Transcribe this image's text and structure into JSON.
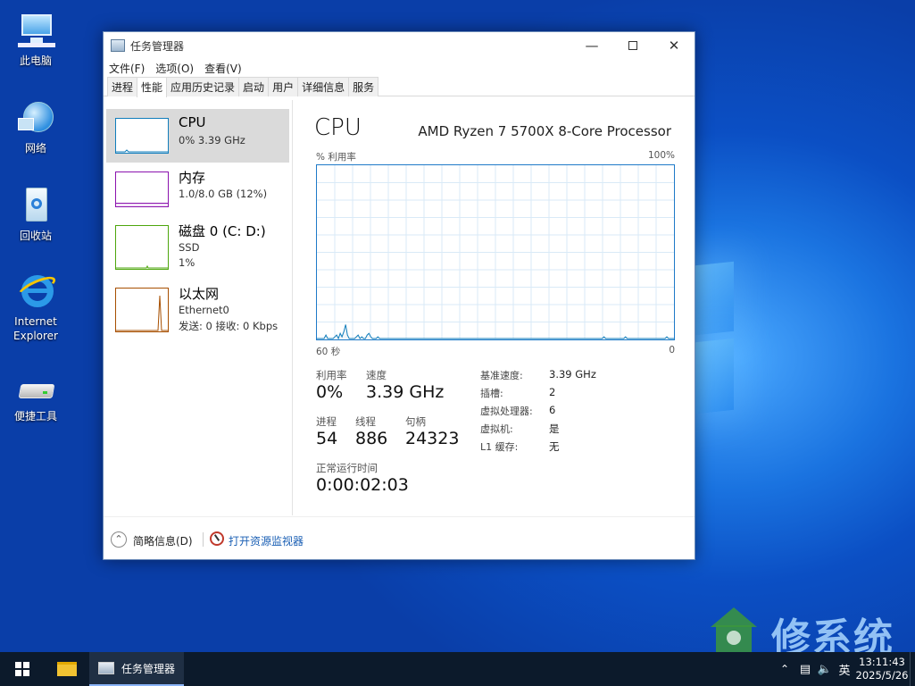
{
  "desktop": {
    "icons": [
      {
        "label": "此电脑"
      },
      {
        "label": "网络"
      },
      {
        "label": "回收站"
      },
      {
        "label": "Internet Explorer"
      },
      {
        "label": "便捷工具"
      }
    ]
  },
  "window": {
    "title": "任务管理器",
    "menu": [
      "文件(F)",
      "选项(O)",
      "查看(V)"
    ],
    "tabs": [
      "进程",
      "性能",
      "应用历史记录",
      "启动",
      "用户",
      "详细信息",
      "服务"
    ],
    "active_tab": "性能"
  },
  "sidebar": {
    "items": [
      {
        "title": "CPU",
        "lines": [
          "0% 3.39 GHz"
        ],
        "color": "#117dbb"
      },
      {
        "title": "内存",
        "lines": [
          "1.0/8.0 GB (12%)"
        ],
        "color": "#8b12ae"
      },
      {
        "title": "磁盘 0 (C: D:)",
        "lines": [
          "SSD",
          "1%"
        ],
        "color": "#4da60c"
      },
      {
        "title": "以太网",
        "lines": [
          "Ethernet0",
          "发送: 0 接收: 0 Kbps"
        ],
        "color": "#a74f01"
      }
    ]
  },
  "cpu_panel": {
    "heading": "CPU",
    "processor": "AMD Ryzen 7 5700X 8-Core Processor",
    "graph_ylabel": "% 利用率",
    "graph_ymax": "100%",
    "graph_xleft": "60 秒",
    "graph_xright": "0",
    "stats": {
      "util_label": "利用率",
      "util_value": "0%",
      "speed_label": "速度",
      "speed_value": "3.39 GHz",
      "proc_label": "进程",
      "proc_value": "54",
      "thread_label": "线程",
      "thread_value": "886",
      "handle_label": "句柄",
      "handle_value": "24323",
      "uptime_label": "正常运行时间",
      "uptime_value": "0:00:02:03"
    },
    "right_stats": [
      {
        "label": "基准速度:",
        "value": "3.39 GHz"
      },
      {
        "label": "插槽:",
        "value": "2"
      },
      {
        "label": "虚拟处理器:",
        "value": "6"
      },
      {
        "label": "虚拟机:",
        "value": "是"
      },
      {
        "label": "L1 缓存:",
        "value": "无"
      }
    ]
  },
  "footer": {
    "summary_label": "简略信息(D)",
    "monitor_label": "打开资源监视器"
  },
  "taskbar": {
    "app_label": "任务管理器",
    "ime": "英",
    "time": "13:11:43",
    "date": "2025/5/26"
  },
  "watermark": {
    "text": "修系统"
  },
  "chart_data": {
    "type": "line",
    "title": "CPU",
    "ylabel": "% 利用率",
    "ylim": [
      0,
      100
    ],
    "x_range_seconds": [
      60,
      0
    ],
    "series": [
      {
        "values": [
          0,
          0,
          0,
          0,
          0,
          2,
          0,
          0,
          0,
          0,
          1,
          2,
          0,
          3,
          1,
          4,
          8,
          2,
          0,
          0,
          0,
          0,
          1,
          2,
          0,
          1,
          0,
          0,
          2,
          3,
          1,
          0,
          0,
          0,
          1,
          0,
          0,
          0,
          0,
          0,
          0,
          0,
          0,
          0,
          0,
          0,
          0,
          0,
          0,
          0,
          0,
          0,
          0,
          0,
          0,
          0,
          0,
          0,
          0,
          0,
          0,
          0,
          0,
          0,
          0,
          0,
          0,
          0,
          0,
          0,
          0,
          0,
          0,
          0,
          0,
          0,
          0,
          0,
          0,
          0,
          0,
          0,
          0,
          0,
          0,
          0,
          0,
          0,
          0,
          0,
          0,
          0,
          0,
          0,
          0,
          0,
          0,
          0,
          0,
          0,
          0,
          0,
          0,
          0,
          0,
          0,
          0,
          0,
          0,
          0,
          0,
          0,
          0,
          0,
          0,
          0,
          0,
          0,
          0,
          0,
          0,
          0,
          0,
          0,
          0,
          0,
          0,
          0,
          0,
          0,
          0,
          0,
          0,
          0,
          0,
          0,
          0,
          0,
          0,
          0,
          0,
          0,
          0,
          0,
          0,
          0,
          0,
          0,
          0,
          0,
          0,
          0,
          0,
          0,
          0,
          0,
          0,
          0,
          0,
          0,
          1,
          0,
          0,
          0,
          0,
          0,
          0,
          0,
          0,
          0,
          0,
          0,
          1,
          0,
          0,
          0,
          0,
          0,
          0,
          0,
          0,
          0,
          0,
          0,
          0,
          0,
          0,
          0,
          0,
          0,
          0,
          0,
          0,
          0,
          0,
          1,
          0,
          0,
          0,
          0
        ]
      }
    ],
    "grid": true
  }
}
